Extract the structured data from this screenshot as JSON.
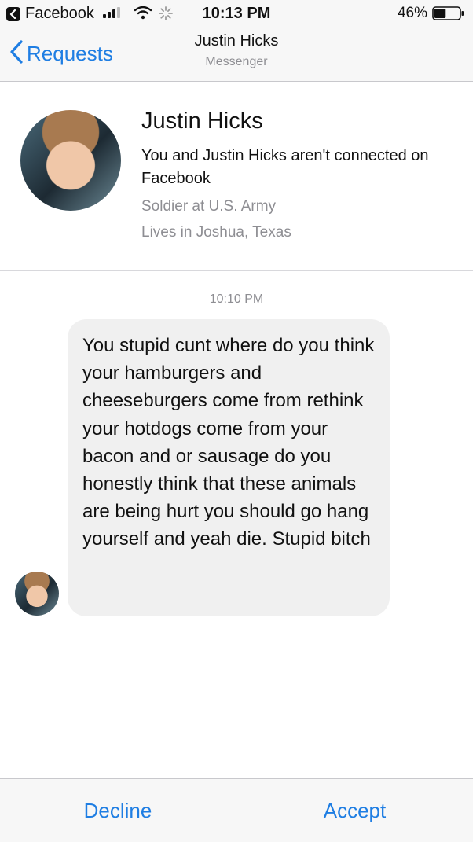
{
  "status_bar": {
    "back_app": "Facebook",
    "time": "10:13 PM",
    "battery": "46%",
    "icons": [
      "back-app-icon",
      "signal-icon",
      "wifi-icon",
      "activity-spinner-icon",
      "battery-icon"
    ],
    "battery_level": 0.46
  },
  "nav": {
    "back_label": "Requests",
    "title": "Justin Hicks",
    "subtitle": "Messenger",
    "accent": "#1f7ee3"
  },
  "profile": {
    "name": "Justin Hicks",
    "connection": "You and Justin Hicks aren't connected on Facebook",
    "work": "Soldier at U.S. Army",
    "location": "Lives in Joshua, Texas"
  },
  "conversation": {
    "timestamp": "10:10 PM",
    "message": "You stupid cunt where do you think your hamburgers and cheeseburgers come from rethink your hotdogs come from your bacon and or sausage do you honestly think that these animals are being hurt you should go hang yourself and yeah die. Stupid bitch"
  },
  "actions": {
    "decline": "Decline",
    "accept": "Accept"
  }
}
